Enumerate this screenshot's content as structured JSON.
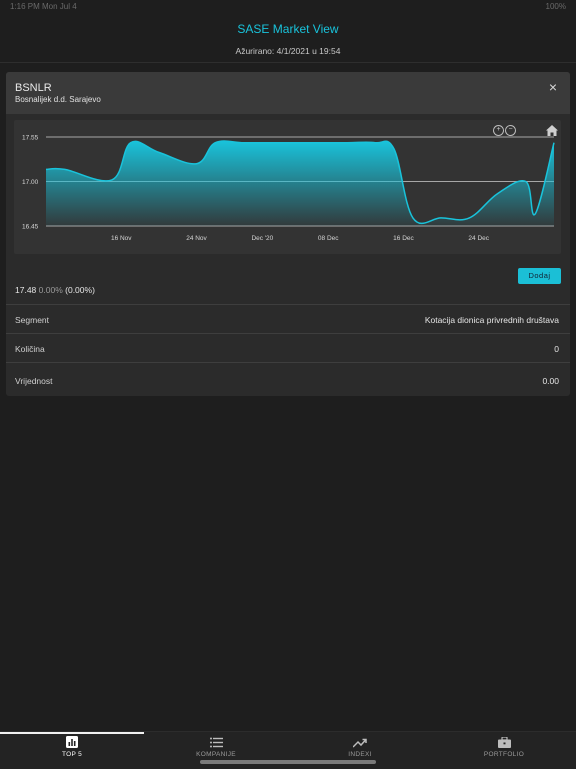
{
  "status_bar": {
    "left": "1:16 PM  Mon Jul 4",
    "right": "100%"
  },
  "header": {
    "title": "SASE Market View",
    "updated": "Ažurirano: 4/1/2021 u 19:54"
  },
  "card": {
    "ticker": "BSNLR",
    "company": "Bosnalijek d.d. Sarajevo",
    "close_symbol": "×",
    "add_label": "Dodaj",
    "price": "17.48",
    "change": "0.00%",
    "change_pct": "(0.00%)",
    "rows": [
      {
        "label": "Segment",
        "value": "Kotacija dionica privrednih društava"
      },
      {
        "label": "Količina",
        "value": "0"
      },
      {
        "label": "Vrijednost",
        "value": "0.00"
      }
    ]
  },
  "chart_data": {
    "type": "area",
    "y_ticks": [
      "17.55",
      "17.00",
      "16.45"
    ],
    "ylim": [
      16.45,
      17.55
    ],
    "x_ticks": [
      "16 Nov",
      "24 Nov",
      "Dec '20",
      "08 Dec",
      "16 Dec",
      "24 Dec"
    ],
    "series_color": "#19c3db",
    "grid": true,
    "series": [
      {
        "x": [
          "2020-11-08",
          "2020-11-10",
          "2020-11-15",
          "2020-11-17",
          "2020-11-20",
          "2020-11-24",
          "2020-11-26",
          "2020-11-29",
          "2020-12-02",
          "2020-12-06",
          "2020-12-10",
          "2020-12-13",
          "2020-12-15",
          "2020-12-17",
          "2020-12-20",
          "2020-12-23",
          "2020-12-26",
          "2020-12-29",
          "2020-12-30",
          "2021-01-01"
        ],
        "values": [
          17.15,
          17.15,
          17.02,
          17.48,
          17.36,
          17.22,
          17.48,
          17.48,
          17.48,
          17.48,
          17.48,
          17.48,
          17.4,
          16.55,
          16.55,
          16.55,
          16.85,
          17.0,
          16.6,
          17.48
        ]
      }
    ]
  },
  "tabs": [
    {
      "label": "TOP 5",
      "icon": "bar-chart-icon",
      "active": true
    },
    {
      "label": "KOMPANIJE",
      "icon": "list-icon",
      "active": false
    },
    {
      "label": "INDEXI",
      "icon": "trending-up-icon",
      "active": false
    },
    {
      "label": "PORTFOLIO",
      "icon": "briefcase-icon",
      "active": false
    }
  ]
}
